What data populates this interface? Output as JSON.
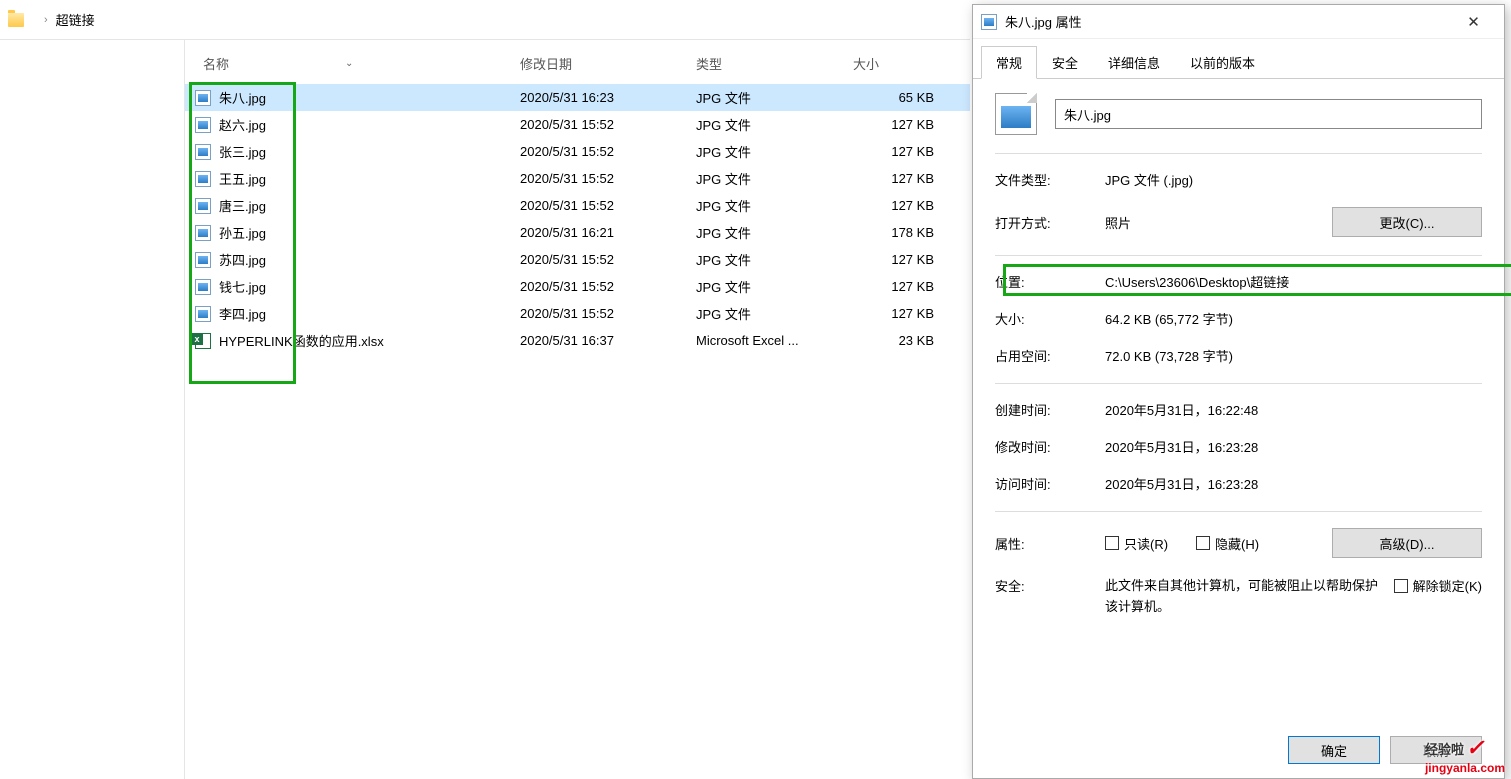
{
  "explorer": {
    "breadcrumb_current": "超链接",
    "columns": {
      "name": "名称",
      "date": "修改日期",
      "type": "类型",
      "size": "大小"
    },
    "files": [
      {
        "icon": "jpg",
        "name": "朱八.jpg",
        "date": "2020/5/31 16:23",
        "type": "JPG 文件",
        "size": "65 KB",
        "selected": true
      },
      {
        "icon": "jpg",
        "name": "赵六.jpg",
        "date": "2020/5/31 15:52",
        "type": "JPG 文件",
        "size": "127 KB",
        "selected": false
      },
      {
        "icon": "jpg",
        "name": "张三.jpg",
        "date": "2020/5/31 15:52",
        "type": "JPG 文件",
        "size": "127 KB",
        "selected": false
      },
      {
        "icon": "jpg",
        "name": "王五.jpg",
        "date": "2020/5/31 15:52",
        "type": "JPG 文件",
        "size": "127 KB",
        "selected": false
      },
      {
        "icon": "jpg",
        "name": "唐三.jpg",
        "date": "2020/5/31 15:52",
        "type": "JPG 文件",
        "size": "127 KB",
        "selected": false
      },
      {
        "icon": "jpg",
        "name": "孙五.jpg",
        "date": "2020/5/31 16:21",
        "type": "JPG 文件",
        "size": "178 KB",
        "selected": false
      },
      {
        "icon": "jpg",
        "name": "苏四.jpg",
        "date": "2020/5/31 15:52",
        "type": "JPG 文件",
        "size": "127 KB",
        "selected": false
      },
      {
        "icon": "jpg",
        "name": "钱七.jpg",
        "date": "2020/5/31 15:52",
        "type": "JPG 文件",
        "size": "127 KB",
        "selected": false
      },
      {
        "icon": "jpg",
        "name": "李四.jpg",
        "date": "2020/5/31 15:52",
        "type": "JPG 文件",
        "size": "127 KB",
        "selected": false
      },
      {
        "icon": "xlsx",
        "name": "HYPERLINK函数的应用.xlsx",
        "date": "2020/5/31 16:37",
        "type": "Microsoft Excel ...",
        "size": "23 KB",
        "selected": false
      }
    ]
  },
  "properties": {
    "title": "朱八.jpg 属性",
    "tabs": [
      "常规",
      "安全",
      "详细信息",
      "以前的版本"
    ],
    "filename": "朱八.jpg",
    "rows": {
      "file_type_label": "文件类型:",
      "file_type_value": "JPG 文件 (.jpg)",
      "open_with_label": "打开方式:",
      "open_with_value": "照片",
      "change_btn": "更改(C)...",
      "location_label": "位置:",
      "location_value": "C:\\Users\\23606\\Desktop\\超链接",
      "size_label": "大小:",
      "size_value": "64.2 KB (65,772 字节)",
      "size_on_disk_label": "占用空间:",
      "size_on_disk_value": "72.0 KB (73,728 字节)",
      "created_label": "创建时间:",
      "created_value": "2020年5月31日，16:22:48",
      "modified_label": "修改时间:",
      "modified_value": "2020年5月31日，16:23:28",
      "accessed_label": "访问时间:",
      "accessed_value": "2020年5月31日，16:23:28",
      "attributes_label": "属性:",
      "readonly_label": "只读(R)",
      "hidden_label": "隐藏(H)",
      "advanced_btn": "高级(D)...",
      "security_label": "安全:",
      "security_text": "此文件来自其他计算机，可能被阻止以帮助保护该计算机。",
      "unblock_label": "解除锁定(K)"
    },
    "buttons": {
      "ok": "确定",
      "cancel": "取消"
    }
  },
  "watermark": {
    "name": "经验啦",
    "url": "jingyanla.com"
  }
}
